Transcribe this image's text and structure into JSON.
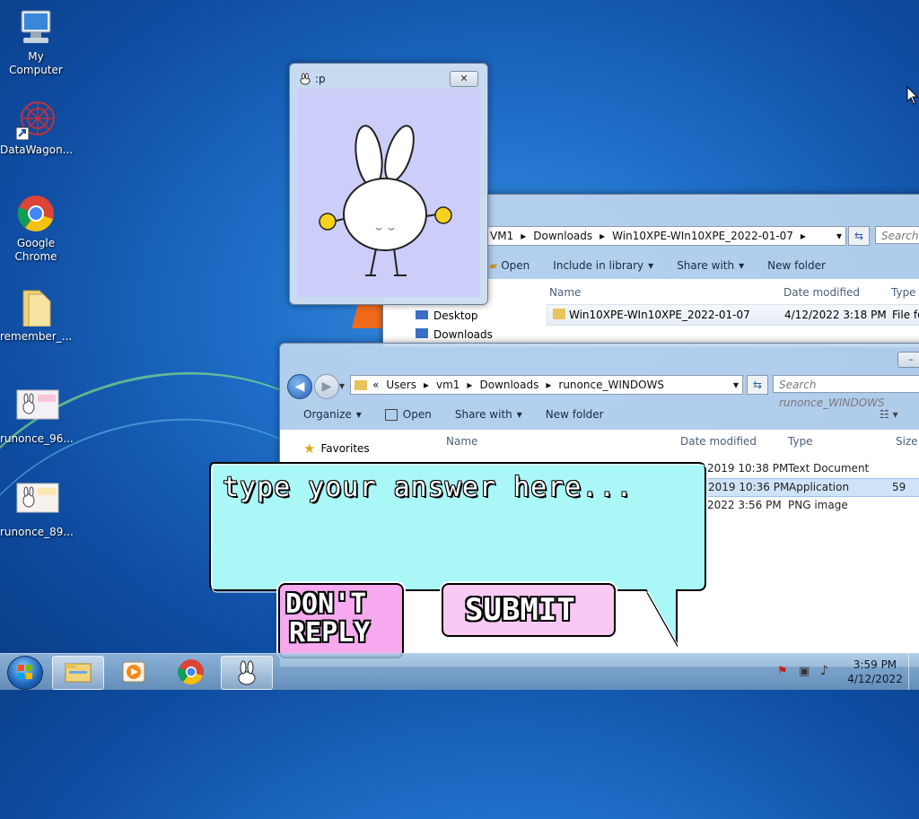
{
  "desktop": {
    "icons": [
      {
        "label": "My Computer"
      },
      {
        "label": "DataWagon..."
      },
      {
        "label": "Google Chrome"
      },
      {
        "label": "remember_..."
      },
      {
        "label": "runonce_96..."
      },
      {
        "label": "runonce_89..."
      }
    ]
  },
  "bunny_window": {
    "title": ":p",
    "close_label": "✕"
  },
  "explorer_back": {
    "breadcrumb": [
      "VM1",
      "Downloads",
      "Win10XPE-WIn10XPE_2022-01-07"
    ],
    "search_placeholder": "Search D",
    "toolbar": {
      "open": "Open",
      "include": "Include in library",
      "share": "Share with",
      "newfolder": "New folder"
    },
    "columns": {
      "name": "Name",
      "date": "Date modified",
      "type": "Type"
    },
    "nav": [
      "Desktop",
      "Downloads"
    ],
    "row": {
      "name": "Win10XPE-WIn10XPE_2022-01-07",
      "date": "4/12/2022 3:18 PM",
      "type": "File fo"
    }
  },
  "explorer_front": {
    "breadcrumb_prefix": "«",
    "breadcrumb": [
      "Users",
      "vm1",
      "Downloads",
      "runonce_WINDOWS"
    ],
    "search_placeholder": "Search runonce_WINDOWS",
    "toolbar": {
      "organize": "Organize",
      "open": "Open",
      "share": "Share with",
      "newfolder": "New folder"
    },
    "columns": {
      "name": "Name",
      "date": "Date modified",
      "type": "Type",
      "size": "Size"
    },
    "favorites": "Favorites",
    "rows": [
      {
        "date": "2019 10:38 PM",
        "type": "Text Document",
        "size": ""
      },
      {
        "date": "2019 10:36 PM",
        "type": "Application",
        "size": "59"
      },
      {
        "date": "2022 3:56 PM",
        "type": "PNG image",
        "size": ""
      }
    ]
  },
  "dialog": {
    "prompt": "type your answer here...",
    "dont_reply": [
      "DON'T",
      "REPLY"
    ],
    "submit": "SUBMIT"
  },
  "taskbar": {
    "time": "3:59 PM",
    "date": "4/12/2022"
  }
}
